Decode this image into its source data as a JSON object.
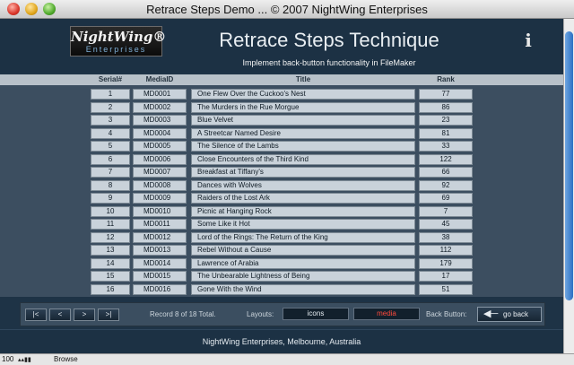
{
  "window": {
    "title": "Retrace Steps Demo  ...  © 2007 NightWing Enterprises"
  },
  "header": {
    "logo_top": "NightWing®",
    "logo_bottom": "Enterprises",
    "title": "Retrace Steps Technique",
    "subtitle": "Implement back-button functionality in FileMaker",
    "info_label": "i"
  },
  "columns": {
    "serial": "Serial#",
    "media": "MediaID",
    "title": "Title",
    "rank": "Rank"
  },
  "records": [
    {
      "serial": "1",
      "media": "MD0001",
      "title": "One Flew Over the Cuckoo's Nest",
      "rank": "77"
    },
    {
      "serial": "2",
      "media": "MD0002",
      "title": "The Murders in the Rue Morgue",
      "rank": "86"
    },
    {
      "serial": "3",
      "media": "MD0003",
      "title": "Blue Velvet",
      "rank": "23"
    },
    {
      "serial": "4",
      "media": "MD0004",
      "title": "A Streetcar Named Desire",
      "rank": "81"
    },
    {
      "serial": "5",
      "media": "MD0005",
      "title": "The Silence of the Lambs",
      "rank": "33"
    },
    {
      "serial": "6",
      "media": "MD0006",
      "title": "Close Encounters of the Third Kind",
      "rank": "122"
    },
    {
      "serial": "7",
      "media": "MD0007",
      "title": "Breakfast at Tiffany's",
      "rank": "66"
    },
    {
      "serial": "8",
      "media": "MD0008",
      "title": "Dances with Wolves",
      "rank": "92"
    },
    {
      "serial": "9",
      "media": "MD0009",
      "title": "Raiders of the Lost Ark",
      "rank": "69"
    },
    {
      "serial": "10",
      "media": "MD0010",
      "title": "Picnic at Hanging Rock",
      "rank": "7"
    },
    {
      "serial": "11",
      "media": "MD0011",
      "title": "Some Like it Hot",
      "rank": "45"
    },
    {
      "serial": "12",
      "media": "MD0012",
      "title": "Lord of the Rings: The Return of the King",
      "rank": "38"
    },
    {
      "serial": "13",
      "media": "MD0013",
      "title": "Rebel Without a Cause",
      "rank": "112"
    },
    {
      "serial": "14",
      "media": "MD0014",
      "title": "Lawrence of Arabia",
      "rank": "179"
    },
    {
      "serial": "15",
      "media": "MD0015",
      "title": "The Unbearable Lightness of Being",
      "rank": "17"
    },
    {
      "serial": "16",
      "media": "MD0016",
      "title": "Gone With the Wind",
      "rank": "51"
    }
  ],
  "nav": {
    "first": "|<",
    "prev": "<",
    "next": ">",
    "last": ">|",
    "record_status": "Record 8 of 18 Total.",
    "layouts_label": "Layouts:",
    "layout_icons": "icons",
    "layout_media": "media",
    "back_label": "Back Button:",
    "back_button": "go back"
  },
  "footer": {
    "text": "NightWing Enterprises, Melbourne, Australia"
  },
  "statusbar": {
    "zoom": "100",
    "mode": "Browse"
  },
  "colors": {
    "active_layout": "#ff4a3c",
    "inactive_layout": "#e6edf2"
  }
}
